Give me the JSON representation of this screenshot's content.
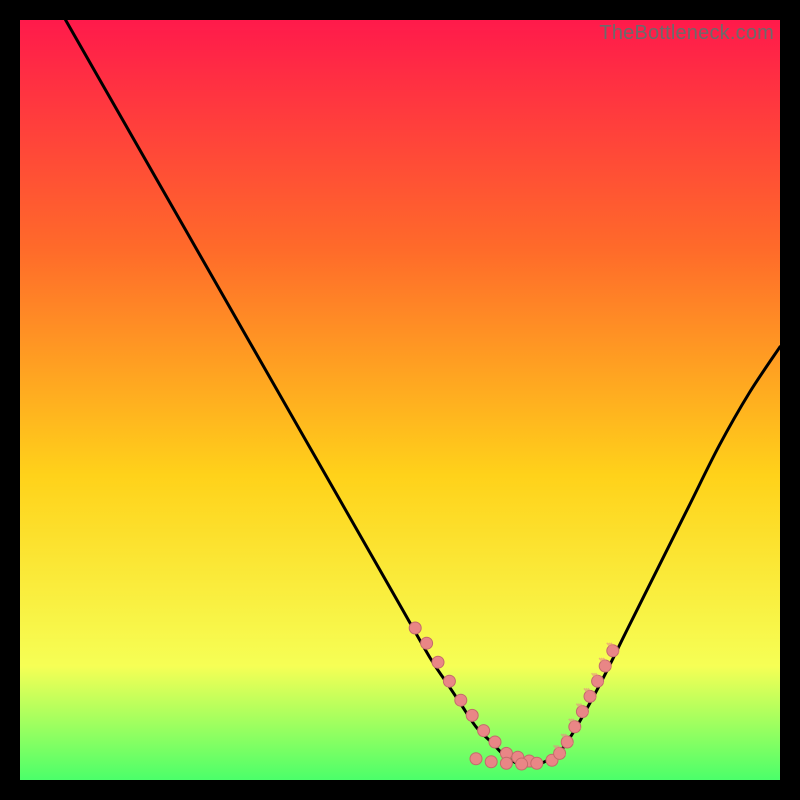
{
  "watermark": "TheBottleneck.com",
  "colors": {
    "bg": "#000000",
    "gradient_top": "#ff1a4b",
    "gradient_mid1": "#ff6a2a",
    "gradient_mid2": "#ffd21a",
    "gradient_bottom1": "#f6ff55",
    "gradient_bottom2": "#4bff6a",
    "curve": "#000000",
    "marker_fill": "#e98686",
    "marker_stroke": "#c46b6b"
  },
  "chart_data": {
    "type": "line",
    "title": "",
    "xlabel": "",
    "ylabel": "",
    "xlim": [
      0,
      100
    ],
    "ylim": [
      0,
      100
    ],
    "series": [
      {
        "name": "bottleneck-curve",
        "x": [
          6,
          10,
          14,
          18,
          22,
          26,
          30,
          34,
          38,
          42,
          46,
          50,
          54,
          56,
          58,
          60,
          62,
          64,
          66,
          68,
          70,
          72,
          76,
          80,
          84,
          88,
          92,
          96,
          100
        ],
        "y": [
          100,
          93,
          86,
          79,
          72,
          65,
          58,
          51,
          44,
          37,
          30,
          23,
          16,
          13,
          10,
          7,
          5,
          3,
          2,
          2,
          3,
          5,
          12,
          20,
          28,
          36,
          44,
          51,
          57
        ]
      }
    ],
    "highlight_left": {
      "name": "left-cluster",
      "x": [
        52,
        53.5,
        55,
        56.5,
        58,
        59.5,
        61,
        62.5,
        64,
        65.5,
        67
      ],
      "y": [
        20,
        18,
        15.5,
        13,
        10.5,
        8.5,
        6.5,
        5,
        3.5,
        3,
        2.5
      ]
    },
    "highlight_right": {
      "name": "right-cluster",
      "x": [
        71,
        72,
        73,
        74,
        75,
        76,
        77,
        78
      ],
      "y": [
        3.5,
        5,
        7,
        9,
        11,
        13,
        15,
        17
      ]
    },
    "highlight_valley": {
      "name": "valley-cluster",
      "x": [
        60,
        62,
        64,
        66,
        68,
        70
      ],
      "y": [
        2.8,
        2.4,
        2.2,
        2.1,
        2.2,
        2.6
      ]
    }
  }
}
